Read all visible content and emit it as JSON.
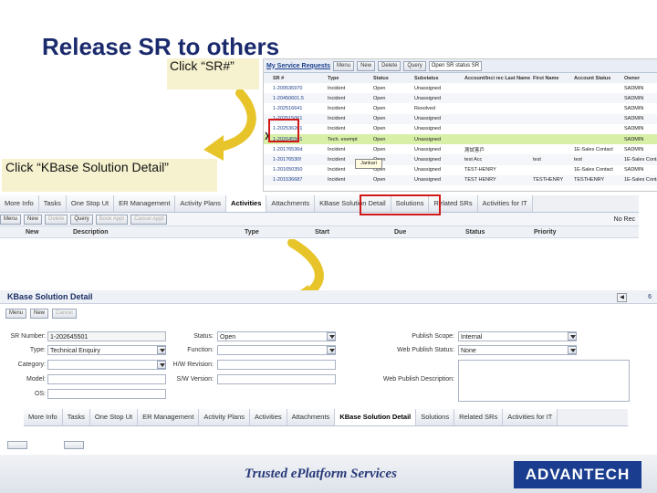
{
  "slide_title": "Release SR to others",
  "callouts": {
    "c1": "Click “SR#”",
    "c2": "Click “KBase Solution Detail”"
  },
  "screen1": {
    "title": "My Service Requests",
    "buttons": [
      "Menu",
      "New",
      "Delete",
      "Query"
    ],
    "query_value": "Open SR status SR",
    "columns": [
      "SR #",
      "Type",
      "Status",
      "Substatus",
      "Account/Inci rec Last Name",
      "First Name",
      "Account Status",
      "Owner"
    ],
    "rows": [
      [
        "1-209536970",
        "Incident",
        "Open",
        "Unassigned",
        "",
        "",
        "",
        "SADMIN"
      ],
      [
        "1-20450601.5",
        "Incident",
        "Open",
        "Unassigned",
        "",
        "",
        "",
        "SADMIN"
      ],
      [
        "1-202516641",
        "Incident",
        "Open",
        "Resolved",
        "",
        "",
        "",
        "SADMIN"
      ],
      [
        "1-202515061",
        "Incident",
        "Open",
        "Unassigned",
        "",
        "",
        "",
        "SADMIN"
      ],
      [
        "1-202536201",
        "Incident",
        "Open",
        "Unassigned",
        "",
        "",
        "",
        "SADMIN"
      ],
      [
        "1-202645501",
        "Tech. exempt",
        "Open",
        "Unassigned",
        "",
        "",
        "",
        "SADMIN"
      ],
      [
        "1-20176536d",
        "Incident",
        "Open",
        "Unassigned",
        "測試客戶",
        "",
        "1E-Sales Contact",
        "SADMIN"
      ],
      [
        "1-20176530f",
        "Incident",
        "Open",
        "Unassigned",
        "test Acc",
        "test",
        "test",
        "1E-Sales Contact"
      ],
      [
        "1-201650350",
        "Incident",
        "Open",
        "Unassigned",
        "TEST-HENRY",
        "",
        "1E-Sales Contact",
        "SADMIN"
      ],
      [
        "1-201536687",
        "Incident",
        "Open",
        "Unassigned",
        "TEST HENRY",
        "TESTHENRY",
        "TESTHENRY",
        "1E-Sales Contact"
      ]
    ],
    "tooltip": "Jankari"
  },
  "screen2": {
    "tabs": [
      "More Info",
      "Tasks",
      "One Stop Ut",
      "ER Management",
      "Activity Plans",
      "Activities",
      "Attachments",
      "KBase Solution Detail",
      "Solutions",
      "Related SRs",
      "Activities for IT"
    ],
    "active_tab": "Activities",
    "toolbar": [
      "Menu",
      "New",
      "Delete",
      "Query",
      "Book Appt",
      "Cancel Appt"
    ],
    "no_records": "No Rec",
    "columns": [
      "New",
      "Description",
      "Type",
      "Start",
      "Due",
      "Status",
      "Priority"
    ]
  },
  "screen3": {
    "title": "KBase Solution Detail",
    "page_num": "6",
    "buttons": [
      "Menu",
      "New",
      "Cancel"
    ],
    "fields": {
      "sr_number_label": "SR Number:",
      "sr_number": "1-202645501",
      "type_label": "Type:",
      "type": "Technical Enquiry",
      "category_label": "Category:",
      "model_label": "Model:",
      "os_label": "OS:",
      "status_label": "Status:",
      "status": "Open",
      "function_label": "Function:",
      "hw_label": "H/W Revision:",
      "sw_label": "S/W Version:",
      "scope_label": "Publish Scope:",
      "scope": "Internal",
      "web_status_label": "Web Publish Status:",
      "web_status": "None",
      "web_desc_label": "Web Publish Description:"
    },
    "bottom_tabs": [
      "More Info",
      "Tasks",
      "One Stop Ut",
      "ER Management",
      "Activity Plans",
      "Activities",
      "Attachments",
      "KBase Solution Detail",
      "Solutions",
      "Related SRs",
      "Activities for IT"
    ],
    "active_bottom_tab": "KBase Solution Detail"
  },
  "footer": {
    "slogan": "Trusted ePlatform Services",
    "logo": "ADVANTECH"
  },
  "colors": {
    "title": "#1a2a6c",
    "highlight": "#d01818",
    "arrow": "#e7c52a",
    "selected_row": "#d8efa8"
  }
}
